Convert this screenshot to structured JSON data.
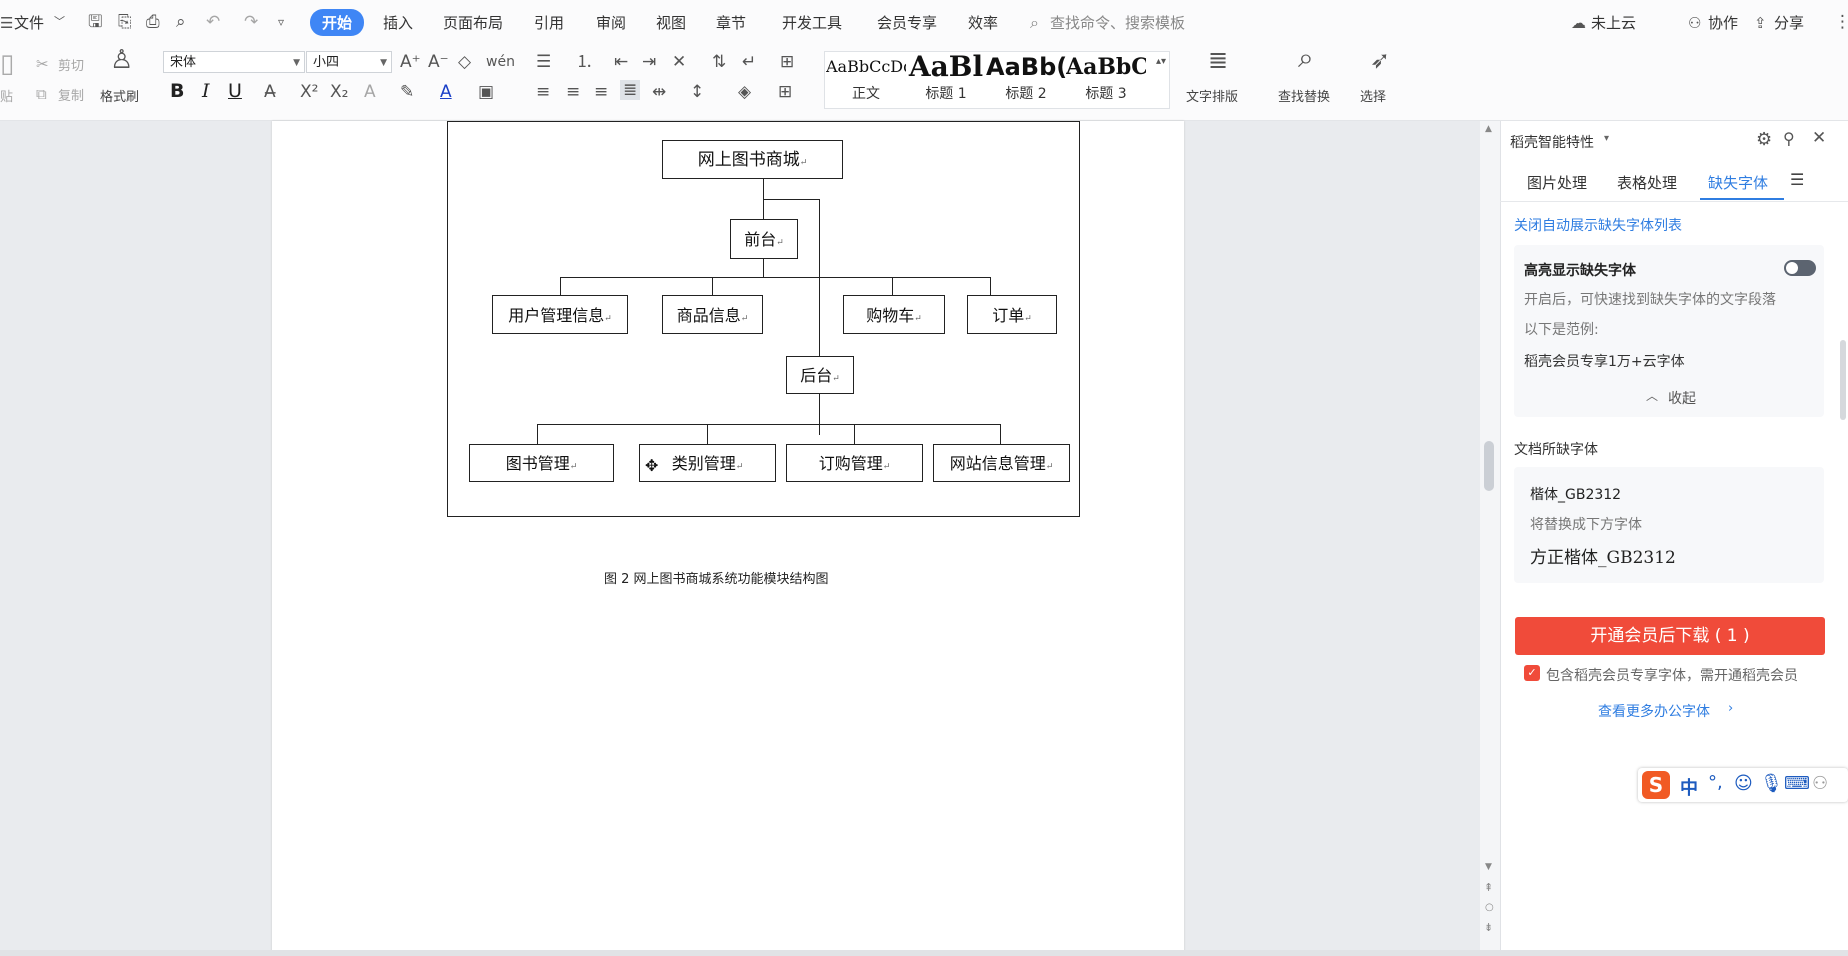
{
  "menubar": {
    "file_label": "文件",
    "tabs": [
      "开始",
      "插入",
      "页面布局",
      "引用",
      "审阅",
      "视图",
      "章节",
      "开发工具",
      "会员专享",
      "效率"
    ],
    "search_placeholder": "查找命令、搜索模板",
    "cloud_label": "未上云",
    "collab_label": "协作",
    "share_label": "分享"
  },
  "toolbar": {
    "cut_label": "剪切",
    "paste_label": "贴",
    "copy_label": "复制",
    "format_painter_label": "格式刷",
    "font_name": "宋体",
    "font_size": "小四",
    "bold": "B",
    "italic": "I",
    "underline": "U",
    "styles": [
      {
        "sample": "AaBbCcDd",
        "name": "正文"
      },
      {
        "sample": "AaBl",
        "name": "标题 1"
      },
      {
        "sample": "AaBb(",
        "name": "标题 2"
      },
      {
        "sample": "AaBbC",
        "name": "标题 3"
      }
    ],
    "text_layout_label": "文字排版",
    "find_replace_label": "查找替换",
    "select_label": "选择"
  },
  "diagram": {
    "root": "网上图书商城",
    "front": "前台",
    "front_children": [
      "用户管理信息",
      "商品信息",
      "购物车",
      "订单"
    ],
    "back": "后台",
    "back_children": [
      "图书管理",
      "类别管理",
      "订购管理",
      "网站信息管理"
    ],
    "caption": "图 2    网上图书商城系统功能模块结构图"
  },
  "panel": {
    "title": "稻壳智能特性",
    "tabs": [
      "图片处理",
      "表格处理",
      "缺失字体"
    ],
    "close_auto_link": "关闭自动展示缺失字体列表",
    "highlight_title": "高亮显示缺失字体",
    "highlight_desc": "开启后，可快速找到缺失字体的文字段落",
    "example_label": "以下是范例:",
    "example_text": "稻壳会员专享1万+云字体",
    "collapse_label": "收起",
    "missing_section_title": "文档所缺字体",
    "missing_font": "楷体_GB2312",
    "replace_label": "将替换成下方字体",
    "replacement_font": "方正楷体_GB2312",
    "download_button": "开通会员后下载 ( 1 )",
    "member_note": "包含稻壳会员专享字体，需开通稻壳会员",
    "more_fonts_link": "查看更多办公字体"
  },
  "ime": {
    "logo": "S",
    "mode": "中"
  },
  "colors": {
    "accent": "#3f86f5",
    "danger": "#f04b3a",
    "link": "#2f7de1"
  }
}
